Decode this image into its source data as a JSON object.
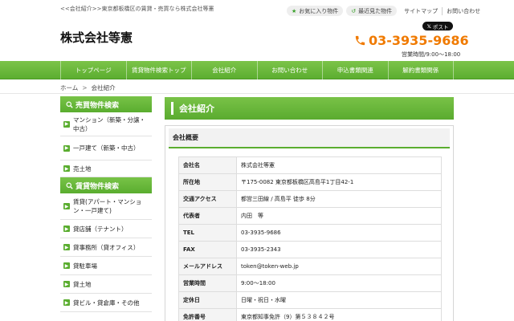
{
  "header": {
    "tagline": "<<会社紹介>>東京都板橋区の賃貸・売買なら株式会社等憲",
    "favorites_label": "お気に入り物件",
    "recent_label": "最近見た物件",
    "sitemap_label": "サイトマップ",
    "contact_label": "お問い合わせ",
    "logo": "株式会社等憲",
    "x_post_label": "ポスト",
    "phone": "03-3935-9686",
    "hours": "営業時間/9:00～18:00"
  },
  "nav": {
    "items": [
      "トップページ",
      "賃貸物件検索トップ",
      "会社紹介",
      "お問い合わせ",
      "申込書類関連",
      "解約書類関係"
    ]
  },
  "breadcrumb": {
    "home": "ホーム",
    "current": "会社紹介"
  },
  "sidebar": {
    "sale_head": "売買物件検索",
    "sale_items": [
      "マンション（新築・分譲・中古）",
      "一戸建て（新築・中古）",
      "売土地"
    ],
    "rent_head": "賃貸物件検索",
    "rent_items": [
      "賃貸(アパート・マンション・一戸建て)",
      "貸店舗（テナント）",
      "貸事務所（貸オフィス）",
      "貸駐車場",
      "貸土地",
      "貸ビル・貸倉庫・その他"
    ]
  },
  "main": {
    "title": "会社紹介",
    "section": "会社概要",
    "rows": [
      {
        "k": "会社名",
        "v": "株式会社等憲"
      },
      {
        "k": "所在地",
        "v": "〒175-0082 東京都板橋区高島平1丁目42-1"
      },
      {
        "k": "交通アクセス",
        "v": "都営三田線 / 高島平 徒歩 8分"
      },
      {
        "k": "代表者",
        "v": "内田　等"
      },
      {
        "k": "TEL",
        "v": "03-3935-9686"
      },
      {
        "k": "FAX",
        "v": "03-3935-2343"
      },
      {
        "k": "メールアドレス",
        "v": "token@token-web.jp"
      },
      {
        "k": "営業時間",
        "v": "9:00～18:00"
      },
      {
        "k": "定休日",
        "v": "日曜・祝日・水曜"
      },
      {
        "k": "免許番号",
        "v": "東京都知事免許（9）第５３８４２号"
      }
    ]
  },
  "colors": {
    "accent": "#5aad2f",
    "phone": "#f07a00"
  }
}
